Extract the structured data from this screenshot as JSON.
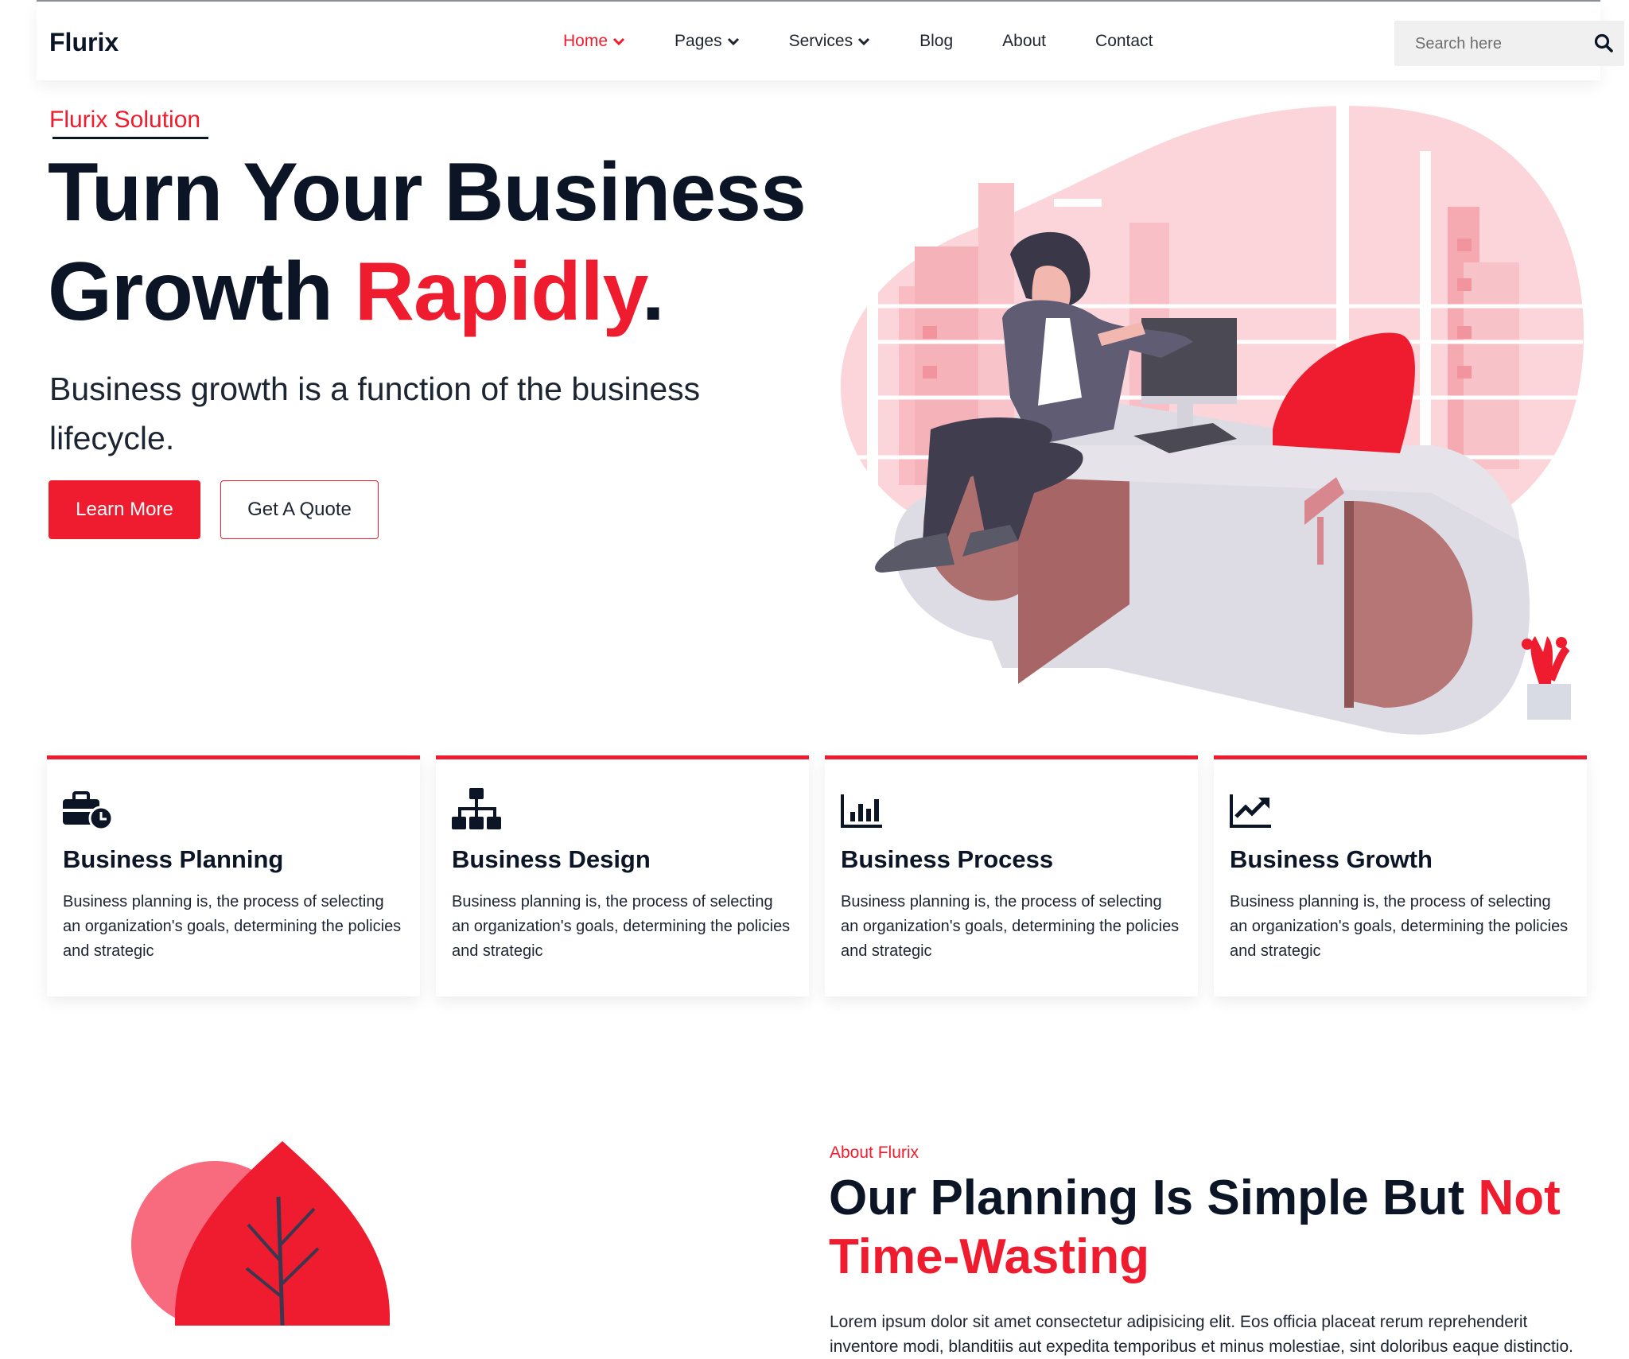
{
  "header": {
    "logo": "Flurix",
    "nav": [
      {
        "label": "Home",
        "active": true,
        "dropdown": true
      },
      {
        "label": "Pages",
        "dropdown": true
      },
      {
        "label": "Services",
        "dropdown": true
      },
      {
        "label": "Blog"
      },
      {
        "label": "About"
      },
      {
        "label": "Contact"
      }
    ],
    "search_placeholder": "Search here"
  },
  "hero": {
    "eyebrow": "Flurix Solution",
    "title_line1": "Turn Your Business",
    "title_line2_prefix": "Growth ",
    "title_line2_accent": "Rapidly",
    "title_line2_suffix": ".",
    "subtitle": "Business growth is a function of the business lifecycle.",
    "primary_button": "Learn More",
    "secondary_button": "Get A Quote"
  },
  "services": [
    {
      "icon": "briefcase-clock-icon",
      "title": "Business Planning",
      "text": "Business planning is, the process of selecting an organization's goals, determining the policies and strategic"
    },
    {
      "icon": "sitemap-icon",
      "title": "Business Design",
      "text": "Business planning is, the process of selecting an organization's goals, determining the policies and strategic"
    },
    {
      "icon": "bar-chart-icon",
      "title": "Business Process",
      "text": "Business planning is, the process of selecting an organization's goals, determining the policies and strategic"
    },
    {
      "icon": "trend-up-icon",
      "title": "Business Growth",
      "text": "Business planning is, the process of selecting an organization's goals, determining the policies and strategic"
    }
  ],
  "about": {
    "eyebrow": "About Flurix",
    "title_prefix": "Our Planning Is Simple But ",
    "title_accent": "Not Time-Wasting",
    "text": "Lorem ipsum dolor sit amet consectetur adipisicing elit. Eos officia placeat rerum reprehenderit inventore modi, blanditiis aut expedita temporibus et minus molestiae, sint doloribus eaque distinctio."
  },
  "colors": {
    "accent": "#ee1c2e",
    "dark": "#0b1526"
  }
}
